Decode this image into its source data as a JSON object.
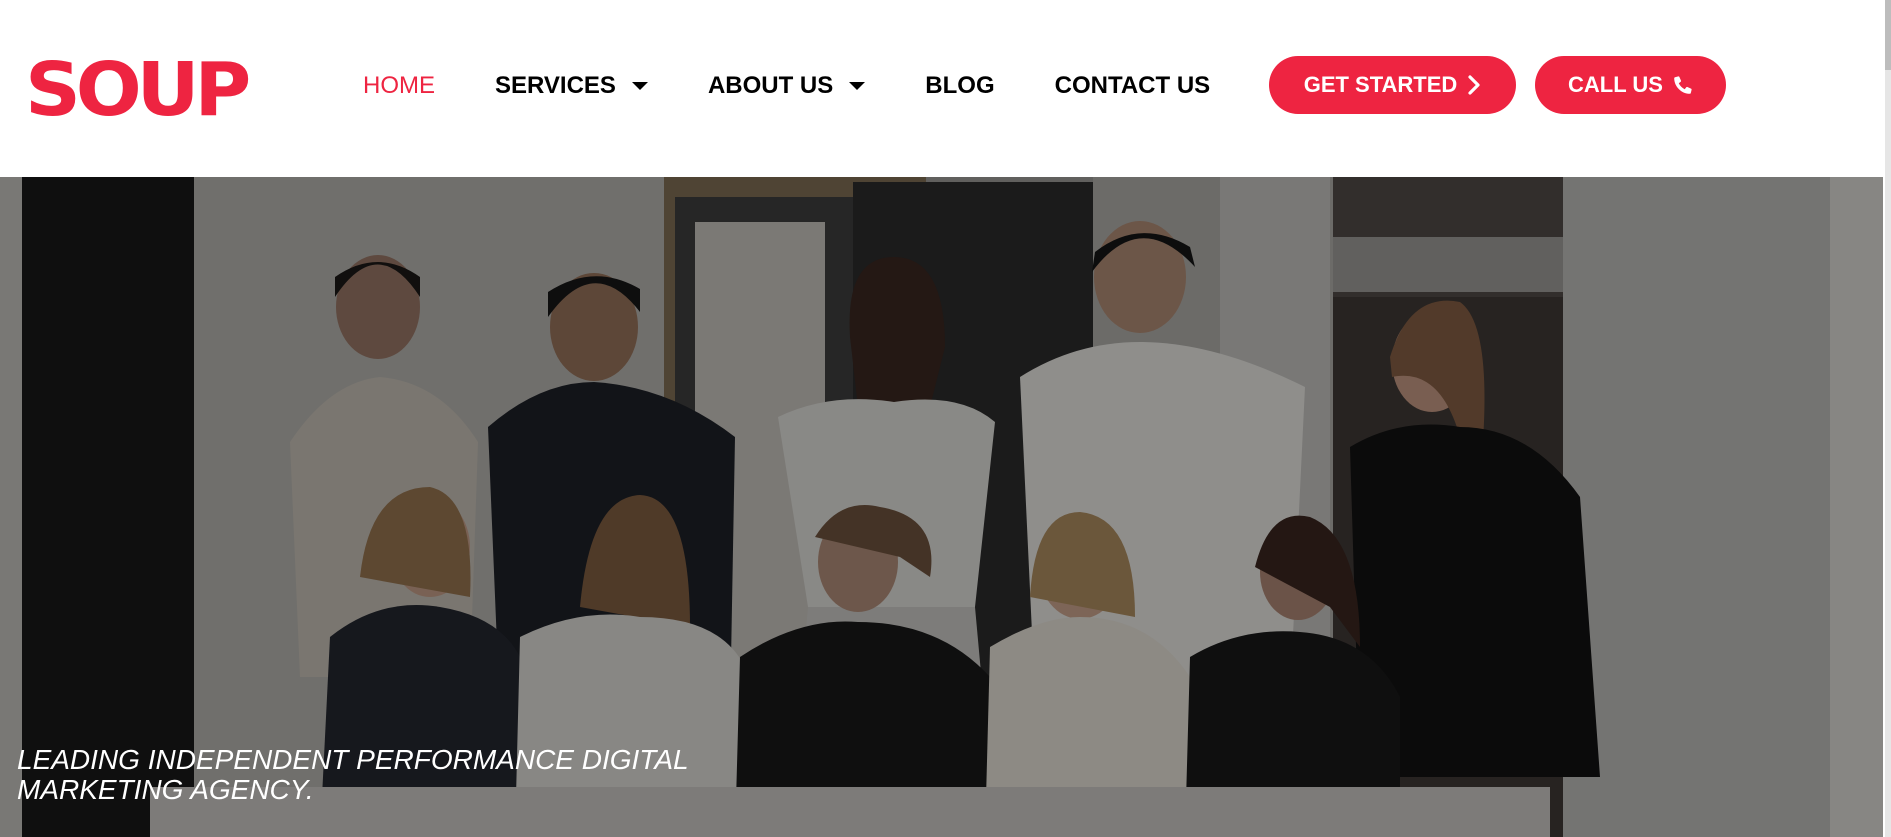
{
  "header": {
    "logo_text": "SOUP",
    "brand_color": "#ee2441",
    "nav": [
      {
        "label": "HOME",
        "active": true
      },
      {
        "label": "SERVICES",
        "dropdown": true
      },
      {
        "label": "ABOUT US",
        "dropdown": true
      },
      {
        "label": "BLOG"
      },
      {
        "label": "CONTACT US"
      }
    ],
    "buttons": {
      "get_started": {
        "label": "GET STARTED",
        "icon": "chevron-right-icon"
      },
      "call_us": {
        "label": "CALL US",
        "icon": "phone-icon"
      }
    }
  },
  "hero": {
    "image": "team-group-photo",
    "tagline_line1": "LEADING INDEPENDENT PERFORMANCE DIGITAL",
    "tagline_line2": "MARKETING AGENCY."
  }
}
